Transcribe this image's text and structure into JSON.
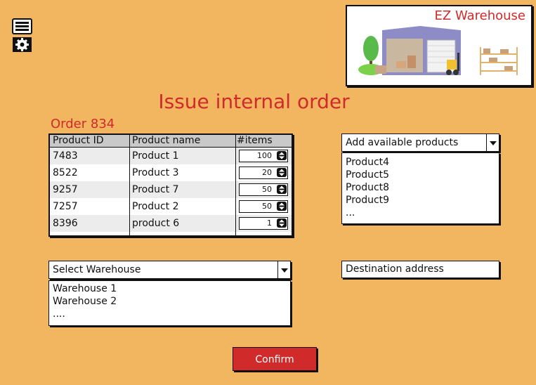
{
  "logo": {
    "title": "EZ Warehouse"
  },
  "page": {
    "title": "Issue internal order"
  },
  "order": {
    "label": "Order 834"
  },
  "table": {
    "headers": [
      "Product ID",
      "Product name",
      "#items"
    ],
    "rows": [
      {
        "id": "7483",
        "name": "Product 1",
        "items": "100"
      },
      {
        "id": "8522",
        "name": "Product 3",
        "items": "20"
      },
      {
        "id": "9257",
        "name": "Product 7",
        "items": "50"
      },
      {
        "id": "7257",
        "name": "Product 2",
        "items": "50"
      },
      {
        "id": "8396",
        "name": "product 6",
        "items": "1"
      }
    ]
  },
  "products_select": {
    "label": "Add available products",
    "options": [
      "Product4",
      "Product5",
      "Product8",
      "Product9",
      "..."
    ]
  },
  "warehouse_select": {
    "label": "Select Warehouse",
    "options": [
      "Warehouse 1",
      "Warehouse 2",
      "...."
    ]
  },
  "destination": {
    "placeholder": "Destination address"
  },
  "confirm": {
    "label": "Confirm"
  },
  "colors": {
    "background": "#f2b560",
    "accent": "#d02a2a"
  },
  "icons": [
    "menu-icon",
    "gear-icon",
    "warehouse-logo-icon",
    "stepper-arrows-icon",
    "chevron-down-icon"
  ]
}
